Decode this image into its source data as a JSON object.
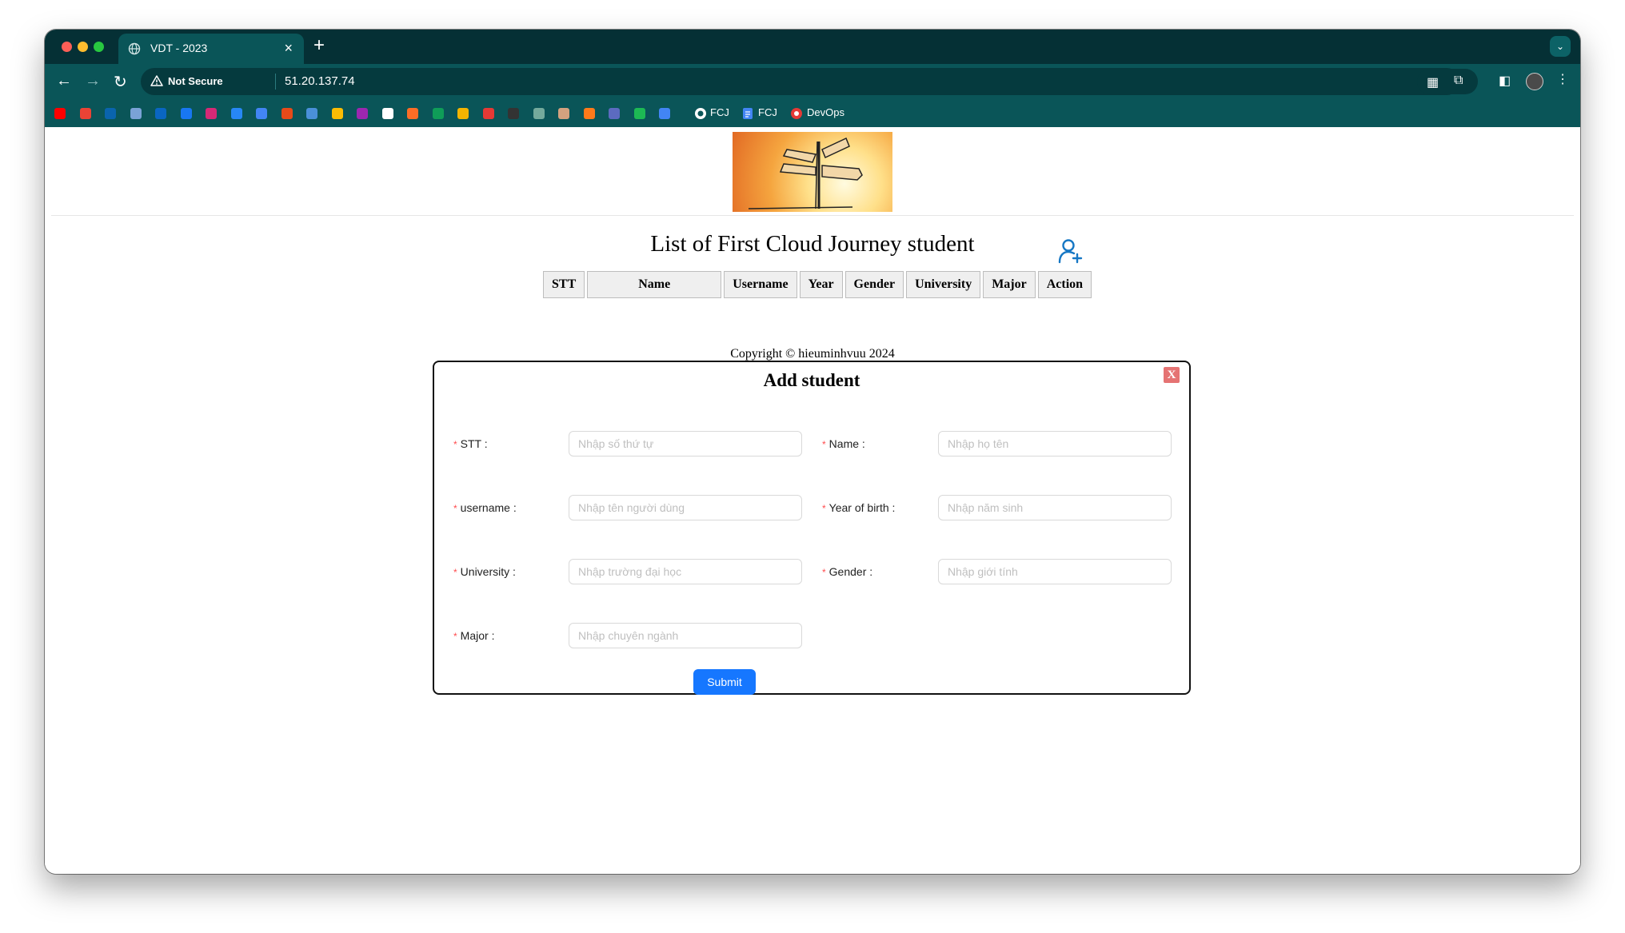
{
  "browser": {
    "tab_title": "VDT - 2023",
    "new_tab_glyph": "+",
    "close_glyph": "×",
    "security_label": "Not Secure",
    "url": "51.20.137.74",
    "bookmarks": [
      {
        "icon": "youtube-icon",
        "color": "#ff0000"
      },
      {
        "icon": "gmail-icon",
        "color": "#ea4335"
      },
      {
        "icon": "outlook-icon",
        "color": "#0a64ad"
      },
      {
        "icon": "bird-icon",
        "color": "#7aa2d6"
      },
      {
        "icon": "linkedin-icon",
        "color": "#0a66c2"
      },
      {
        "icon": "facebook-icon",
        "color": "#1877f2"
      },
      {
        "icon": "instagram-icon",
        "color": "#d62976"
      },
      {
        "icon": "vk-icon",
        "color": "#2787f5"
      },
      {
        "icon": "translate-icon",
        "color": "#4285f4"
      },
      {
        "icon": "app-icon",
        "color": "#e64a19"
      },
      {
        "icon": "calendar-icon",
        "color": "#4a90d9"
      },
      {
        "icon": "drive-icon",
        "color": "#fbbc04"
      },
      {
        "icon": "play-icon",
        "color": "#9c27b0"
      },
      {
        "icon": "github-icon",
        "color": "#ffffff"
      },
      {
        "icon": "gitlab-icon",
        "color": "#fc6d26"
      },
      {
        "icon": "sheets-icon",
        "color": "#0f9d58"
      },
      {
        "icon": "bolt-icon",
        "color": "#f4b400"
      },
      {
        "icon": "slides-icon",
        "color": "#e53935"
      },
      {
        "icon": "dots-icon",
        "color": "#333333"
      },
      {
        "icon": "chatgpt-icon",
        "color": "#74aa9c"
      },
      {
        "icon": "anthropic-icon",
        "color": "#d4a27f"
      },
      {
        "icon": "cube-icon",
        "color": "#ff7a1a"
      },
      {
        "icon": "cloud-icon",
        "color": "#5c6bc0"
      },
      {
        "icon": "leaf-icon",
        "color": "#1db954"
      },
      {
        "icon": "search-icon",
        "color": "#4285f4"
      }
    ],
    "bookmark_labels": [
      {
        "icon": "github-icon",
        "label": "FCJ"
      },
      {
        "icon": "docs-icon",
        "label": "FCJ"
      },
      {
        "icon": "devops-icon",
        "label": "DevOps"
      }
    ]
  },
  "page": {
    "title": "List of First Cloud Journey student",
    "table_headers": [
      "STT",
      "Name",
      "Username",
      "Year",
      "Gender",
      "University",
      "Major",
      "Action"
    ],
    "copyright": "Copyright © hieuminhvuu 2024"
  },
  "modal": {
    "title": "Add student",
    "close_label": "X",
    "required_mark": "*",
    "fields": {
      "stt": {
        "label": "STT",
        "placeholder": "Nhập số thứ tự"
      },
      "name": {
        "label": "Name",
        "placeholder": "Nhập họ tên"
      },
      "username": {
        "label": "username",
        "placeholder": "Nhập tên người dùng"
      },
      "year": {
        "label": "Year of birth",
        "placeholder": "Nhập năm sinh"
      },
      "university": {
        "label": "University",
        "placeholder": "Nhập trường đại học"
      },
      "gender": {
        "label": "Gender",
        "placeholder": "Nhập giới tính"
      },
      "major": {
        "label": "Major",
        "placeholder": "Nhập chuyên ngành"
      }
    },
    "submit_label": "Submit",
    "accent_color": "#1677ff"
  }
}
